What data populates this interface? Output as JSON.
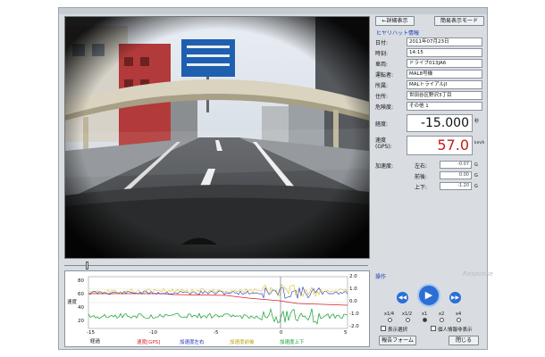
{
  "panel": {
    "top_buttons": [
      "←詳細表示",
      "簡易表示モード"
    ],
    "section_title": "ヒヤリハット情報",
    "info_rows": [
      {
        "label": "日付:",
        "value": "2011年07月23日"
      },
      {
        "label": "時刻:",
        "value": "14:15"
      },
      {
        "label": "車両:",
        "value": "ドライブ013JA6"
      },
      {
        "label": "運転者:",
        "value": "MAL8号機"
      },
      {
        "label": "所属:",
        "value": "MALトライアルJI"
      },
      {
        "label": "住所:",
        "value": "世田谷区野沢3丁目"
      },
      {
        "label": "危険度:",
        "value": "その他 1"
      }
    ],
    "longitude_label": "経度:",
    "longitude_value": "-15.000",
    "longitude_unit": "秒",
    "speed_label": "速度\n(GPS):",
    "speed_value": "57.0",
    "speed_unit": "km/h",
    "accel_label": "加速度:",
    "accel_rows": [
      {
        "label": "左右:",
        "value": "-0.07",
        "unit": "G"
      },
      {
        "label": "前後:",
        "value": "0.00",
        "unit": "G"
      },
      {
        "label": "上下:",
        "value": "-1.20",
        "unit": "G"
      }
    ]
  },
  "controls": {
    "title": "操作",
    "speed_options": [
      "x1/4",
      "x1/2",
      "x1",
      "x2",
      "x4"
    ],
    "selected_speed": "x1",
    "checkbox1": "表示選択",
    "checkbox2": "個人情報非表示",
    "report_button": "報告フォーム",
    "close_button": "閉じる"
  },
  "graph": {
    "left_axis_label": "速度",
    "left_ticks": [
      "80",
      "60",
      "40",
      "20"
    ],
    "right_ticks": [
      "2.0",
      "1.0",
      "0.0",
      "-1.0",
      "-2.0"
    ],
    "x_ticks": [
      "-15",
      "-10",
      "-5",
      "0",
      "5"
    ],
    "x_label": "経過",
    "legend": [
      {
        "name": "速度[GPS]",
        "color": "#d42020"
      },
      {
        "name": "加速度左右",
        "color": "#2030c0"
      },
      {
        "name": "加速度前後",
        "color": "#d8c020"
      },
      {
        "name": "加速度上下",
        "color": "#10a030"
      }
    ]
  },
  "colors": {
    "speed_value": "#c81a1a",
    "accent": "#1a3fb4",
    "play_button": "#2b6fd6"
  },
  "watermark": "Response"
}
